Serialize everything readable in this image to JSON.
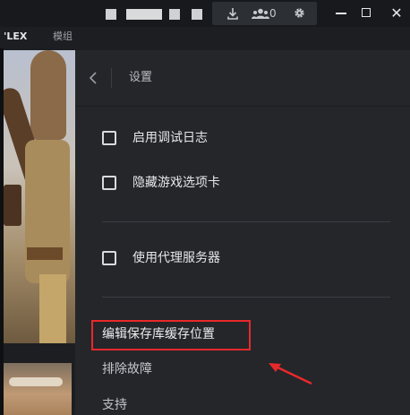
{
  "window": {
    "download_count": "0",
    "controls": {
      "minimize": "minimize",
      "maximize": "maximize",
      "close": "✕"
    }
  },
  "nav": {
    "item_1": "'LEX",
    "item_2": "模组"
  },
  "settings": {
    "title": "设置",
    "options": [
      {
        "label": "启用调试日志",
        "checked": false
      },
      {
        "label": "隐藏游戏选项卡",
        "checked": false
      },
      {
        "label": "使用代理服务器",
        "checked": false
      }
    ],
    "menu": [
      {
        "label": "编辑保存库缓存位置"
      },
      {
        "label": "排除故障"
      },
      {
        "label": "支持"
      }
    ]
  },
  "icons": {
    "back": "chevron-left-icon",
    "download": "download-icon",
    "friends": "friends-icon",
    "settings": "gear-icon"
  },
  "colors": {
    "panel_bg": "#24262a",
    "app_bg": "#1c1e22",
    "annotation_red": "#e8292b"
  }
}
